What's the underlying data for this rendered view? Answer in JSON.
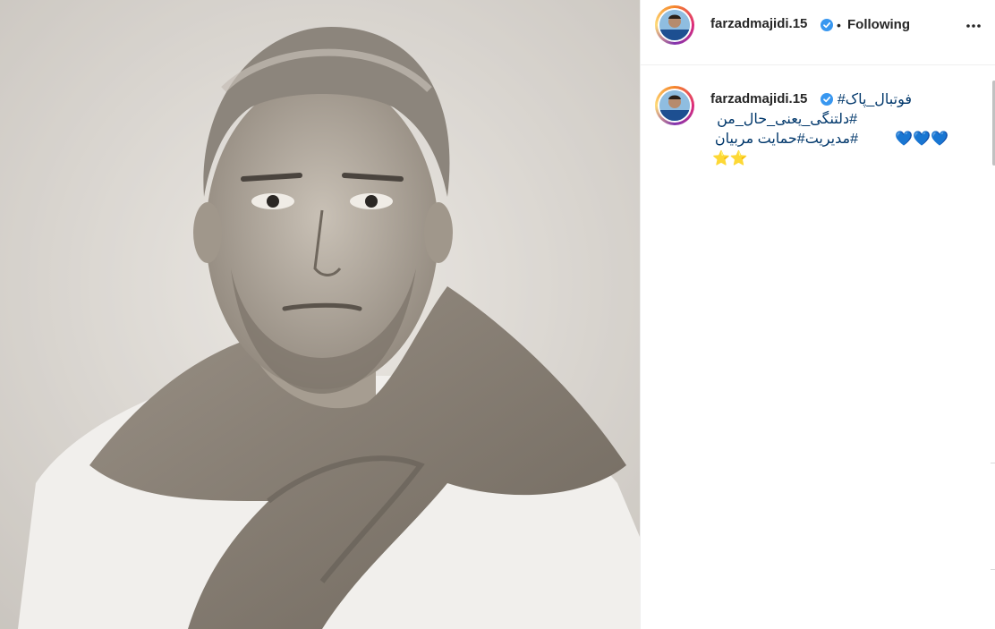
{
  "post": {
    "photo_icon": "portrait-photo",
    "header": {
      "username": "farzadmajidi.15",
      "separator": "•",
      "follow_state": "Following",
      "verified_icon": "verified-badge-icon",
      "more_icon": "more-options-icon"
    },
    "caption": {
      "username": "farzadmajidi.15",
      "line1": "فوتبال_پاک#",
      "line2": "#دلتنگی_یعنی_حال_من",
      "line3_text": "#مدیریت#حمایت مربیان",
      "line3_emoji": "💙💙💙",
      "line4_emoji": "⭐⭐"
    }
  },
  "colors": {
    "verified": "#3897f0",
    "heart_blue": "#3db4f2",
    "star": "#f5c518",
    "border": "#efefef"
  }
}
